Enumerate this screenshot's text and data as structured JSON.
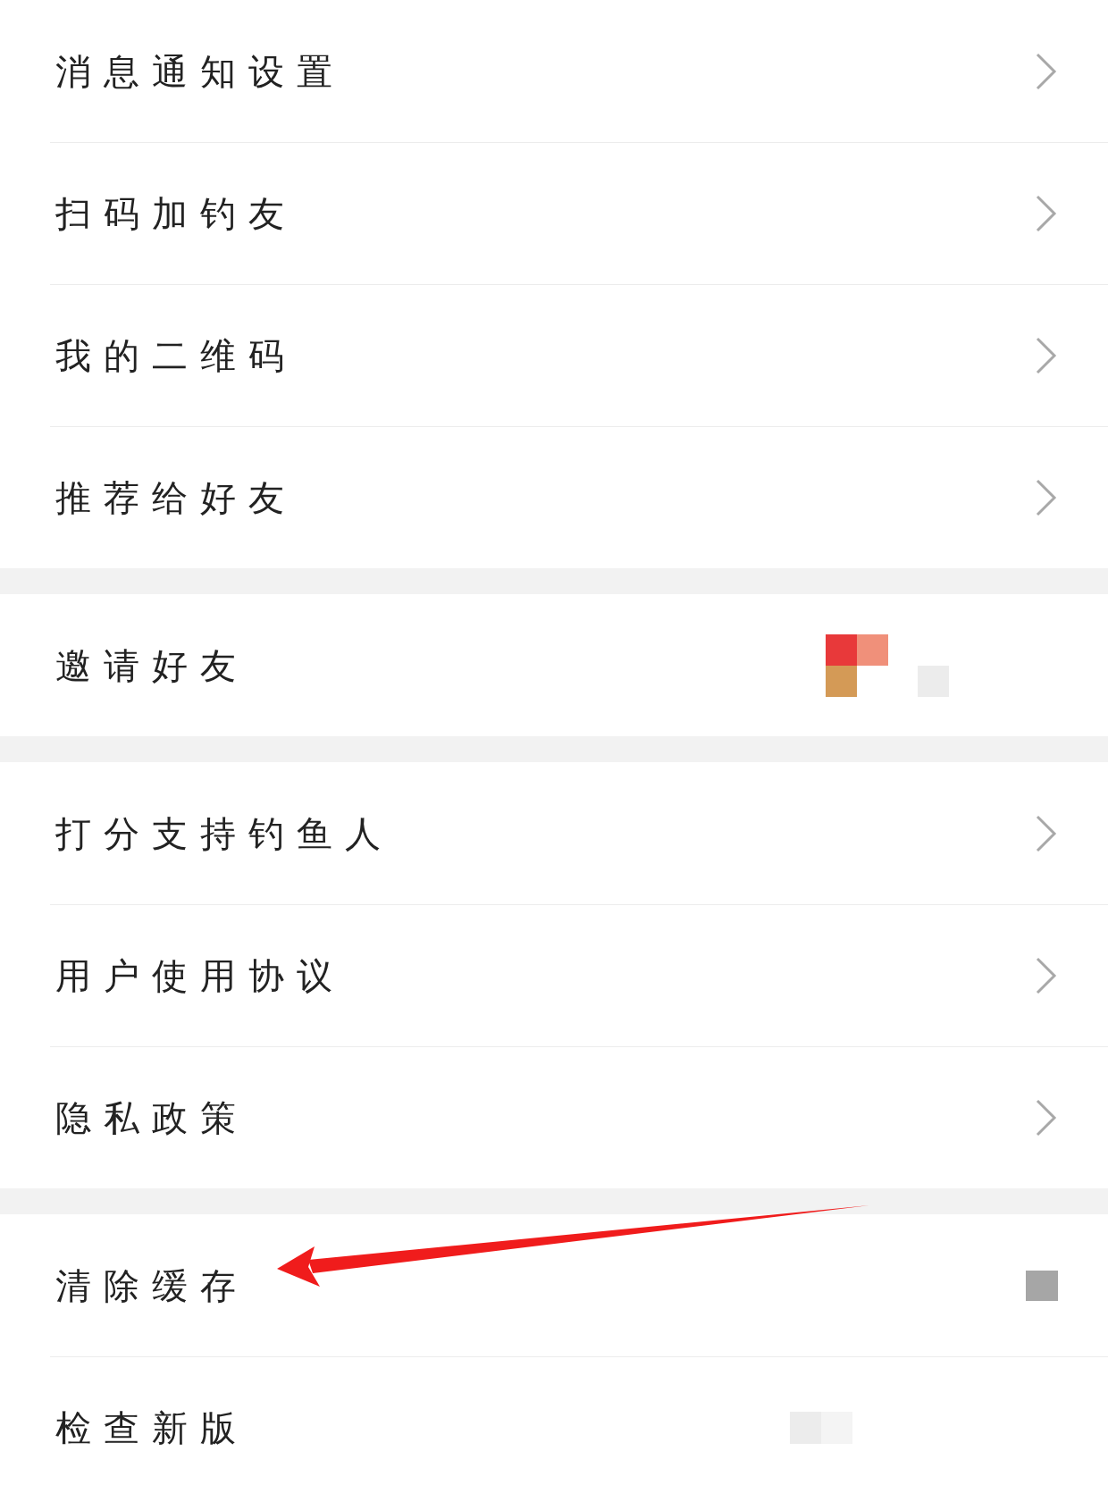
{
  "groups": [
    {
      "items": [
        {
          "label": "消息通知设置",
          "chevron": true
        },
        {
          "label": "扫码加钓友",
          "chevron": true
        },
        {
          "label": "我的二维码",
          "chevron": true
        },
        {
          "label": "推荐给好友",
          "chevron": true
        }
      ]
    },
    {
      "items": [
        {
          "label": "邀请好友",
          "chevron": false,
          "kind": "mosaic"
        }
      ]
    },
    {
      "items": [
        {
          "label": "打分支持钓鱼人",
          "chevron": true
        },
        {
          "label": "用户使用协议",
          "chevron": true
        },
        {
          "label": "隐私政策",
          "chevron": true
        }
      ]
    },
    {
      "items": [
        {
          "label": "清除缓存",
          "chevron": false,
          "kind": "blurred-value"
        },
        {
          "label": "检查新版",
          "chevron": false,
          "kind": "blurred-faint"
        }
      ]
    }
  ]
}
